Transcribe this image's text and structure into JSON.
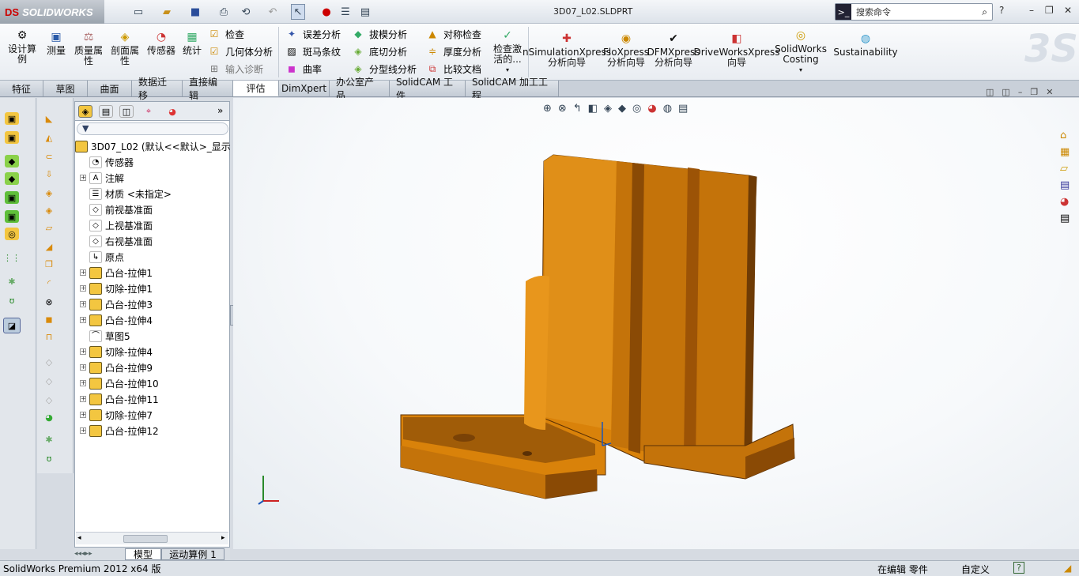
{
  "app": {
    "logo": "SOLIDWORKS",
    "document_title": "3D07_L02.SLDPRT"
  },
  "search": {
    "placeholder": "搜索命令"
  },
  "ribbon": {
    "design_study": "设计算例",
    "measure": "测量",
    "mass_props": "质量属性",
    "section_props": "剖面属性",
    "sensor": "传感器",
    "statistics": "统计",
    "check": "检查",
    "geometry_analysis": "几何体分析",
    "import_diagnostics": "输入诊断",
    "deviation_analysis": "误差分析",
    "zebra_stripes": "斑马条纹",
    "curvature": "曲率",
    "draft_analysis": "拔模分析",
    "undercut_analysis": "底切分析",
    "parting_line_analysis": "分型线分析",
    "symmetry_check": "对称检查",
    "thickness_analysis": "厚度分析",
    "compare_documents": "比较文档",
    "check_active": "检查激活的...",
    "simulation_xpress": "nSimulationXpress 分析向导",
    "flo_xpress": "FloXpress 分析向导",
    "dfm_xpress": "DFMXpress 分析向导",
    "driveworks_xpress": "DriveWorksXpress 向导",
    "costing": "SolidWorks Costing",
    "sustainability": "Sustainability"
  },
  "tabs": [
    "特征",
    "草图",
    "曲面",
    "数据迁移",
    "直接编辑",
    "评估",
    "DimXpert",
    "办公室产品",
    "SolidCAM 工件",
    "SolidCAM 加工工程"
  ],
  "active_tab": "评估",
  "tree": {
    "root": "3D07_L02 (默认<<默认>_显示",
    "items": [
      {
        "label": "传感器",
        "expand": false
      },
      {
        "label": "注解",
        "expand": true
      },
      {
        "label": "材质 <未指定>",
        "expand": false
      },
      {
        "label": "前视基准面",
        "expand": false
      },
      {
        "label": "上视基准面",
        "expand": false
      },
      {
        "label": "右视基准面",
        "expand": false
      },
      {
        "label": "原点",
        "expand": false
      },
      {
        "label": "凸台-拉伸1",
        "expand": true
      },
      {
        "label": "切除-拉伸1",
        "expand": true
      },
      {
        "label": "凸台-拉伸3",
        "expand": true
      },
      {
        "label": "凸台-拉伸4",
        "expand": true
      },
      {
        "label": "草图5",
        "expand": false
      },
      {
        "label": "切除-拉伸4",
        "expand": true
      },
      {
        "label": "凸台-拉伸9",
        "expand": true
      },
      {
        "label": "凸台-拉伸10",
        "expand": true
      },
      {
        "label": "凸台-拉伸11",
        "expand": true
      },
      {
        "label": "切除-拉伸7",
        "expand": true
      },
      {
        "label": "凸台-拉伸12",
        "expand": true
      }
    ]
  },
  "bottom_tabs": [
    "模型",
    "运动算例 1"
  ],
  "status": {
    "version": "SolidWorks Premium 2012 x64 版",
    "editing": "在编辑 零件",
    "units": "自定义"
  },
  "colors": {
    "part": "#d9820a",
    "part_dark": "#8a4a05",
    "part_light": "#f0a12a",
    "accent": "#1a56b8"
  }
}
